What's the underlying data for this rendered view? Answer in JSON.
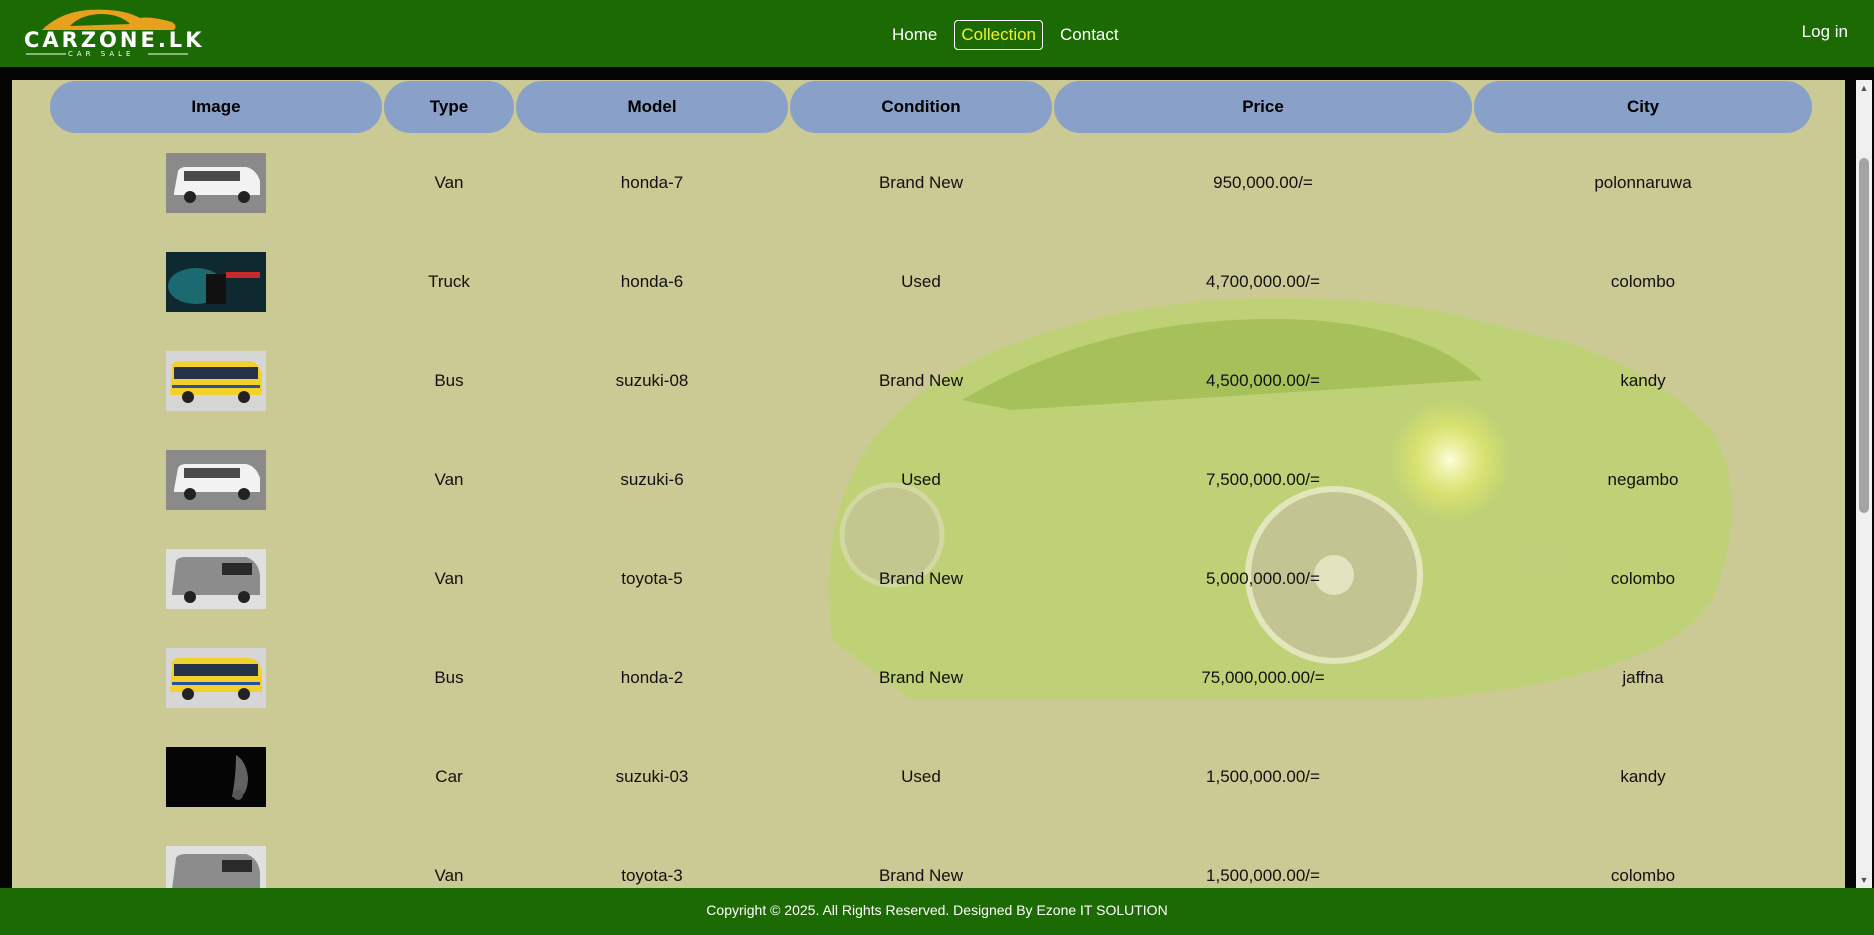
{
  "brand": {
    "name": "CARZONE.LK",
    "tagline": "CAR SALE"
  },
  "nav": {
    "items": [
      "Home",
      "Collection",
      "Contact"
    ],
    "active": "Collection",
    "login_label": "Log in"
  },
  "table": {
    "headers": [
      "Image",
      "Type",
      "Model",
      "Condition",
      "Price",
      "City"
    ],
    "rows": [
      {
        "image": "white-van",
        "type": "Van",
        "model": "honda-7",
        "condition": "Brand New",
        "price": "950,000.00/=",
        "city": "polonnaruwa"
      },
      {
        "image": "dark-truck",
        "type": "Truck",
        "model": "honda-6",
        "condition": "Used",
        "price": "4,700,000.00/=",
        "city": "colombo"
      },
      {
        "image": "yellow-bus",
        "type": "Bus",
        "model": "suzuki-08",
        "condition": "Brand New",
        "price": "4,500,000.00/=",
        "city": "kandy"
      },
      {
        "image": "white-van",
        "type": "Van",
        "model": "suzuki-6",
        "condition": "Used",
        "price": "7,500,000.00/=",
        "city": "negambo"
      },
      {
        "image": "grey-van",
        "type": "Van",
        "model": "toyota-5",
        "condition": "Brand New",
        "price": "5,000,000.00/=",
        "city": "colombo"
      },
      {
        "image": "yellow-bus",
        "type": "Bus",
        "model": "honda-2",
        "condition": "Brand New",
        "price": "75,000,000.00/=",
        "city": "jaffna"
      },
      {
        "image": "dark-car",
        "type": "Car",
        "model": "suzuki-03",
        "condition": "Used",
        "price": "1,500,000.00/=",
        "city": "kandy"
      },
      {
        "image": "grey-van",
        "type": "Van",
        "model": "toyota-3",
        "condition": "Brand New",
        "price": "1,500,000.00/=",
        "city": "colombo"
      }
    ]
  },
  "footer": {
    "text": "Copyright © 2025. All Rights Reserved. Designed By Ezone IT SOLUTION"
  },
  "colors": {
    "header_bg": "#1c6a04",
    "content_bg": "#cbc994",
    "table_header_bg": "#89a0c8",
    "active_nav": "#f2f22a"
  }
}
